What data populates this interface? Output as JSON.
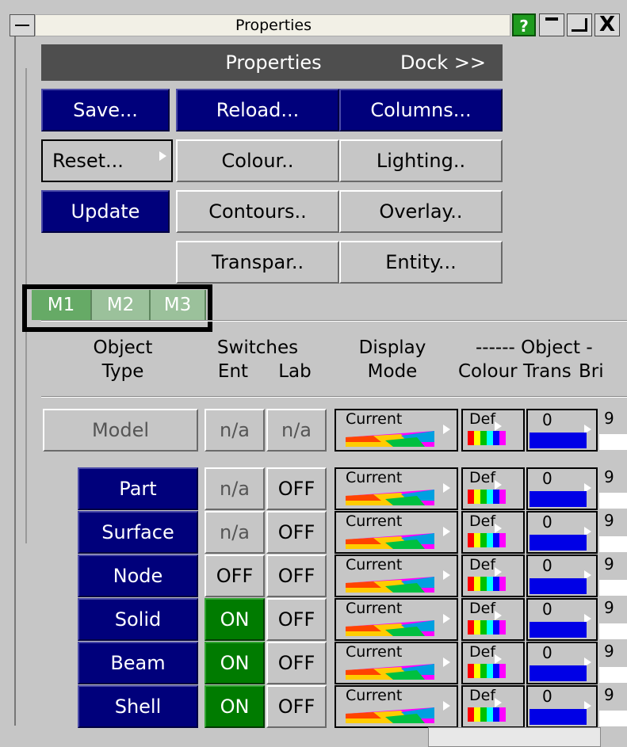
{
  "window": {
    "title": "Properties",
    "help_label": "?",
    "close_label": "X"
  },
  "header": {
    "title": "Properties",
    "dock_label": "Dock >>"
  },
  "buttons": {
    "save": "Save...",
    "reload": "Reload...",
    "columns": "Columns...",
    "reset": "Reset...",
    "colour": "Colour..",
    "lighting": "Lighting..",
    "update": "Update",
    "contours": "Contours..",
    "overlay": "Overlay..",
    "transpar": "Transpar..",
    "entity": "Entity..."
  },
  "model_tabs": [
    {
      "label": "M1",
      "active": true
    },
    {
      "label": "M2",
      "active": false
    },
    {
      "label": "M3",
      "active": false
    }
  ],
  "columns": {
    "object_type_1": "Object",
    "object_type_2": "Type",
    "switches": "Switches",
    "ent": "Ent",
    "lab": "Lab",
    "display_1": "Display",
    "display_2": "Mode",
    "object_group": "------ Object -",
    "colour": "Colour",
    "trans": "Trans",
    "bri": "Bri"
  },
  "model_row": {
    "type": "Model",
    "ent": "n/a",
    "lab": "n/a",
    "display_mode": "Current",
    "colour": "Def",
    "trans": "0",
    "bri": "9"
  },
  "rows": [
    {
      "type": "Part",
      "ent": "n/a",
      "lab": "OFF",
      "display_mode": "Current",
      "colour": "Def",
      "trans": "0",
      "bri": "9"
    },
    {
      "type": "Surface",
      "ent": "n/a",
      "lab": "OFF",
      "display_mode": "Current",
      "colour": "Def",
      "trans": "0",
      "bri": "9"
    },
    {
      "type": "Node",
      "ent": "OFF",
      "lab": "OFF",
      "display_mode": "Current",
      "colour": "Def",
      "trans": "0",
      "bri": "9"
    },
    {
      "type": "Solid",
      "ent": "ON",
      "lab": "OFF",
      "display_mode": "Current",
      "colour": "Def",
      "trans": "0",
      "bri": "9"
    },
    {
      "type": "Beam",
      "ent": "ON",
      "lab": "OFF",
      "display_mode": "Current",
      "colour": "Def",
      "trans": "0",
      "bri": "9"
    },
    {
      "type": "Shell",
      "ent": "ON",
      "lab": "OFF",
      "display_mode": "Current",
      "colour": "Def",
      "trans": "0",
      "bri": "9"
    }
  ],
  "colors": {
    "button_blue": "#00007b",
    "on_green": "#007b00",
    "tab_green": "#66aa66",
    "trans_blue": "#0000e6"
  }
}
